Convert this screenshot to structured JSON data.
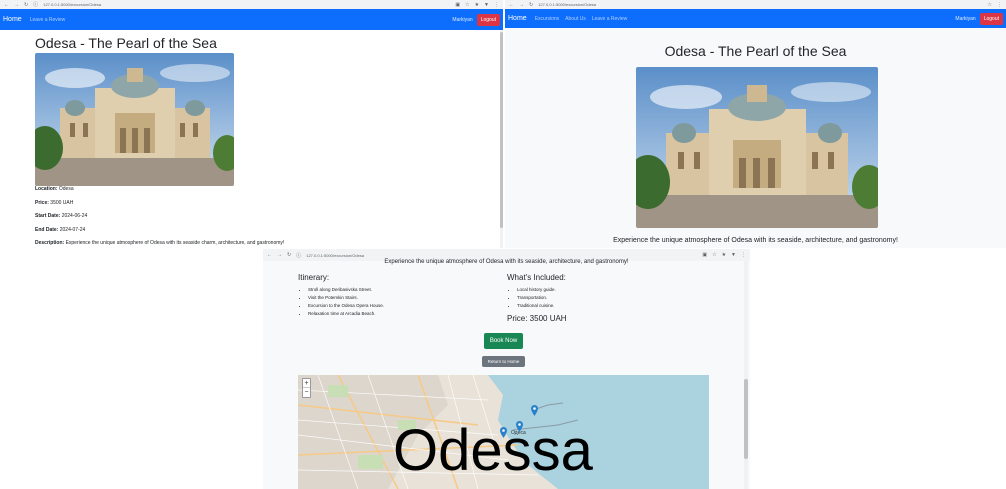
{
  "browser": {
    "url_main": "127.0.0.1:5000/excursion/Odesa",
    "url_secondary": "127.0.0.1:5000/excursion/Odesa"
  },
  "navbar": {
    "brand": "Home",
    "links": [
      "Excursions",
      "About Us",
      "Leave a Review"
    ],
    "leave_review": "Leave a Review",
    "user": "Markiyan",
    "logout": "Logout"
  },
  "page": {
    "title": "Odesa - The Pearl of the Sea",
    "location_label": "Location:",
    "location": "Odesa",
    "price_label": "Price:",
    "price": "3500 UAH",
    "start_label": "Start Date:",
    "start": "2024-06-24",
    "end_label": "End Date:",
    "end": "2024-07-24",
    "description_label": "Description:",
    "description": "Experience the unique atmosphere of Odesa with its seaside charm, architecture, and gastronomy!",
    "subtitle": "Experience the unique atmosphere of Odesa with its seaside, architecture, and gastronomy!"
  },
  "itinerary": {
    "heading": "Itinerary:",
    "items": [
      "Stroll along Deribasivska Street.",
      "Visit the Potemkin Stairs.",
      "Excursion to the Odesa Opera House.",
      "Relaxation time at Arcadia Beach."
    ]
  },
  "included": {
    "heading": "What's Included:",
    "items": [
      "Local history guide.",
      "Transportation.",
      "Traditional cuisine."
    ],
    "price": "Price: 3500 UAH"
  },
  "actions": {
    "book": "Book Now",
    "back": "Return to Home"
  },
  "map": {
    "city_label": "Одеса",
    "zoom_in": "+",
    "zoom_out": "−"
  },
  "overlay": {
    "caption": "Odessa"
  },
  "colors": {
    "navbar": "#0d6efd",
    "logout": "#dc3545",
    "book": "#198754",
    "back": "#6c757d",
    "marker": "#2a81cb"
  }
}
